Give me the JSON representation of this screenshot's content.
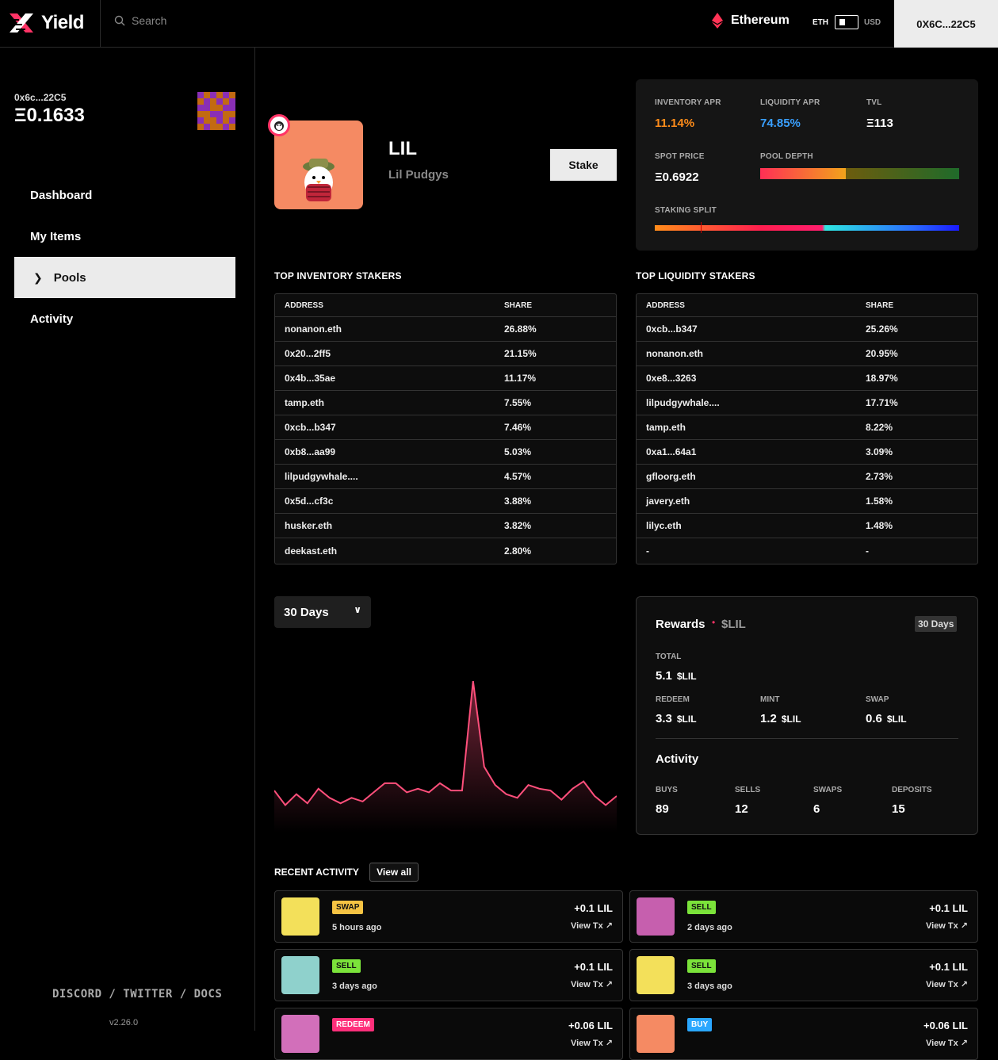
{
  "header": {
    "logo_text": "Yield",
    "search_placeholder": "Search",
    "network": "Ethereum",
    "currency_left": "ETH",
    "currency_right": "USD",
    "wallet": "0X6C...22C5"
  },
  "sidebar": {
    "address": "0x6c...22C5",
    "balance": "Ξ0.1633",
    "nav": [
      "Dashboard",
      "My Items",
      "Pools",
      "Activity"
    ],
    "active_index": 2,
    "footer_links": "DISCORD / TWITTER / DOCS",
    "version": "v2.26.0"
  },
  "pool": {
    "symbol": "LIL",
    "name": "Lil Pudgys",
    "stake_label": "Stake"
  },
  "stats": {
    "inventory_apr_label": "INVENTORY APR",
    "inventory_apr": "11.14%",
    "liquidity_apr_label": "LIQUIDITY APR",
    "liquidity_apr": "74.85%",
    "tvl_label": "TVL",
    "tvl": "Ξ113",
    "spot_price_label": "SPOT PRICE",
    "spot_price": "Ξ0.6922",
    "pool_depth_label": "POOL DEPTH",
    "pool_depth_fraction": 0.43,
    "staking_split_label": "STAKING SPLIT",
    "staking_split_fraction": 0.85,
    "colors": {
      "inventory": "#ff8c1a",
      "liquidity": "#3aa0ff"
    }
  },
  "inventory_stakers": {
    "title": "TOP INVENTORY STAKERS",
    "col_address": "ADDRESS",
    "col_share": "SHARE",
    "rows": [
      [
        "nonanon.eth",
        "26.88%"
      ],
      [
        "0x20...2ff5",
        "21.15%"
      ],
      [
        "0x4b...35ae",
        "11.17%"
      ],
      [
        "tamp.eth",
        "7.55%"
      ],
      [
        "0xcb...b347",
        "7.46%"
      ],
      [
        "0xb8...aa99",
        "5.03%"
      ],
      [
        "lilpudgywhale....",
        "4.57%"
      ],
      [
        "0x5d...cf3c",
        "3.88%"
      ],
      [
        "husker.eth",
        "3.82%"
      ],
      [
        "deekast.eth",
        "2.80%"
      ]
    ]
  },
  "liquidity_stakers": {
    "title": "TOP LIQUIDITY STAKERS",
    "col_address": "ADDRESS",
    "col_share": "SHARE",
    "rows": [
      [
        "0xcb...b347",
        "25.26%"
      ],
      [
        "nonanon.eth",
        "20.95%"
      ],
      [
        "0xe8...3263",
        "18.97%"
      ],
      [
        "lilpudgywhale....",
        "17.71%"
      ],
      [
        "tamp.eth",
        "8.22%"
      ],
      [
        "0xa1...64a1",
        "3.09%"
      ],
      [
        "gfloorg.eth",
        "2.73%"
      ],
      [
        "javery.eth",
        "1.58%"
      ],
      [
        "lilyc.eth",
        "1.48%"
      ],
      [
        "-",
        "-"
      ]
    ]
  },
  "range": {
    "label": "30 Days"
  },
  "chart_data": {
    "type": "area",
    "title": "",
    "xlabel": "",
    "ylabel": "",
    "color": "#ff4f7b",
    "values": [
      23,
      15,
      21,
      16,
      24,
      19,
      16,
      19,
      17,
      22,
      27,
      27,
      22,
      24,
      22,
      27,
      23,
      23,
      83,
      36,
      26,
      21,
      19,
      26,
      24,
      23,
      18,
      24,
      28,
      20,
      15,
      20
    ]
  },
  "rewards": {
    "title": "Rewards",
    "token": "$LIL",
    "period": "30 Days",
    "total_label": "TOTAL",
    "total": "5.1",
    "redeem_label": "REDEEM",
    "redeem": "3.3",
    "mint_label": "MINT",
    "mint": "1.2",
    "swap_label": "SWAP",
    "swap": "0.6",
    "activity_title": "Activity",
    "buys_label": "BUYS",
    "buys": "89",
    "sells_label": "SELLS",
    "sells": "12",
    "swaps_label": "SWAPS",
    "swaps": "6",
    "deposits_label": "DEPOSITS",
    "deposits": "15"
  },
  "recent": {
    "title": "RECENT ACTIVITY",
    "view_all": "View all",
    "view_tx": "View Tx",
    "items": [
      {
        "type": "SWAP",
        "when": "5 hours ago",
        "amount": "+0.1 LIL",
        "tag_color": "#f6c343",
        "thumb": "#f3e05a"
      },
      {
        "type": "SELL",
        "when": "2 days ago",
        "amount": "+0.1 LIL",
        "tag_color": "#7be33a",
        "thumb": "#c65fae"
      },
      {
        "type": "SELL",
        "when": "3 days ago",
        "amount": "+0.1 LIL",
        "tag_color": "#7be33a",
        "thumb": "#8fd1cc"
      },
      {
        "type": "SELL",
        "when": "3 days ago",
        "amount": "+0.1 LIL",
        "tag_color": "#7be33a",
        "thumb": "#f3e05a"
      },
      {
        "type": "REDEEM",
        "when": "",
        "amount": "+0.06 LIL",
        "tag_color": "#ff2f7a",
        "thumb": "#d26fba"
      },
      {
        "type": "BUY",
        "when": "",
        "amount": "+0.06 LIL",
        "tag_color": "#2aa7ff",
        "thumb": "#f58a63"
      }
    ]
  }
}
